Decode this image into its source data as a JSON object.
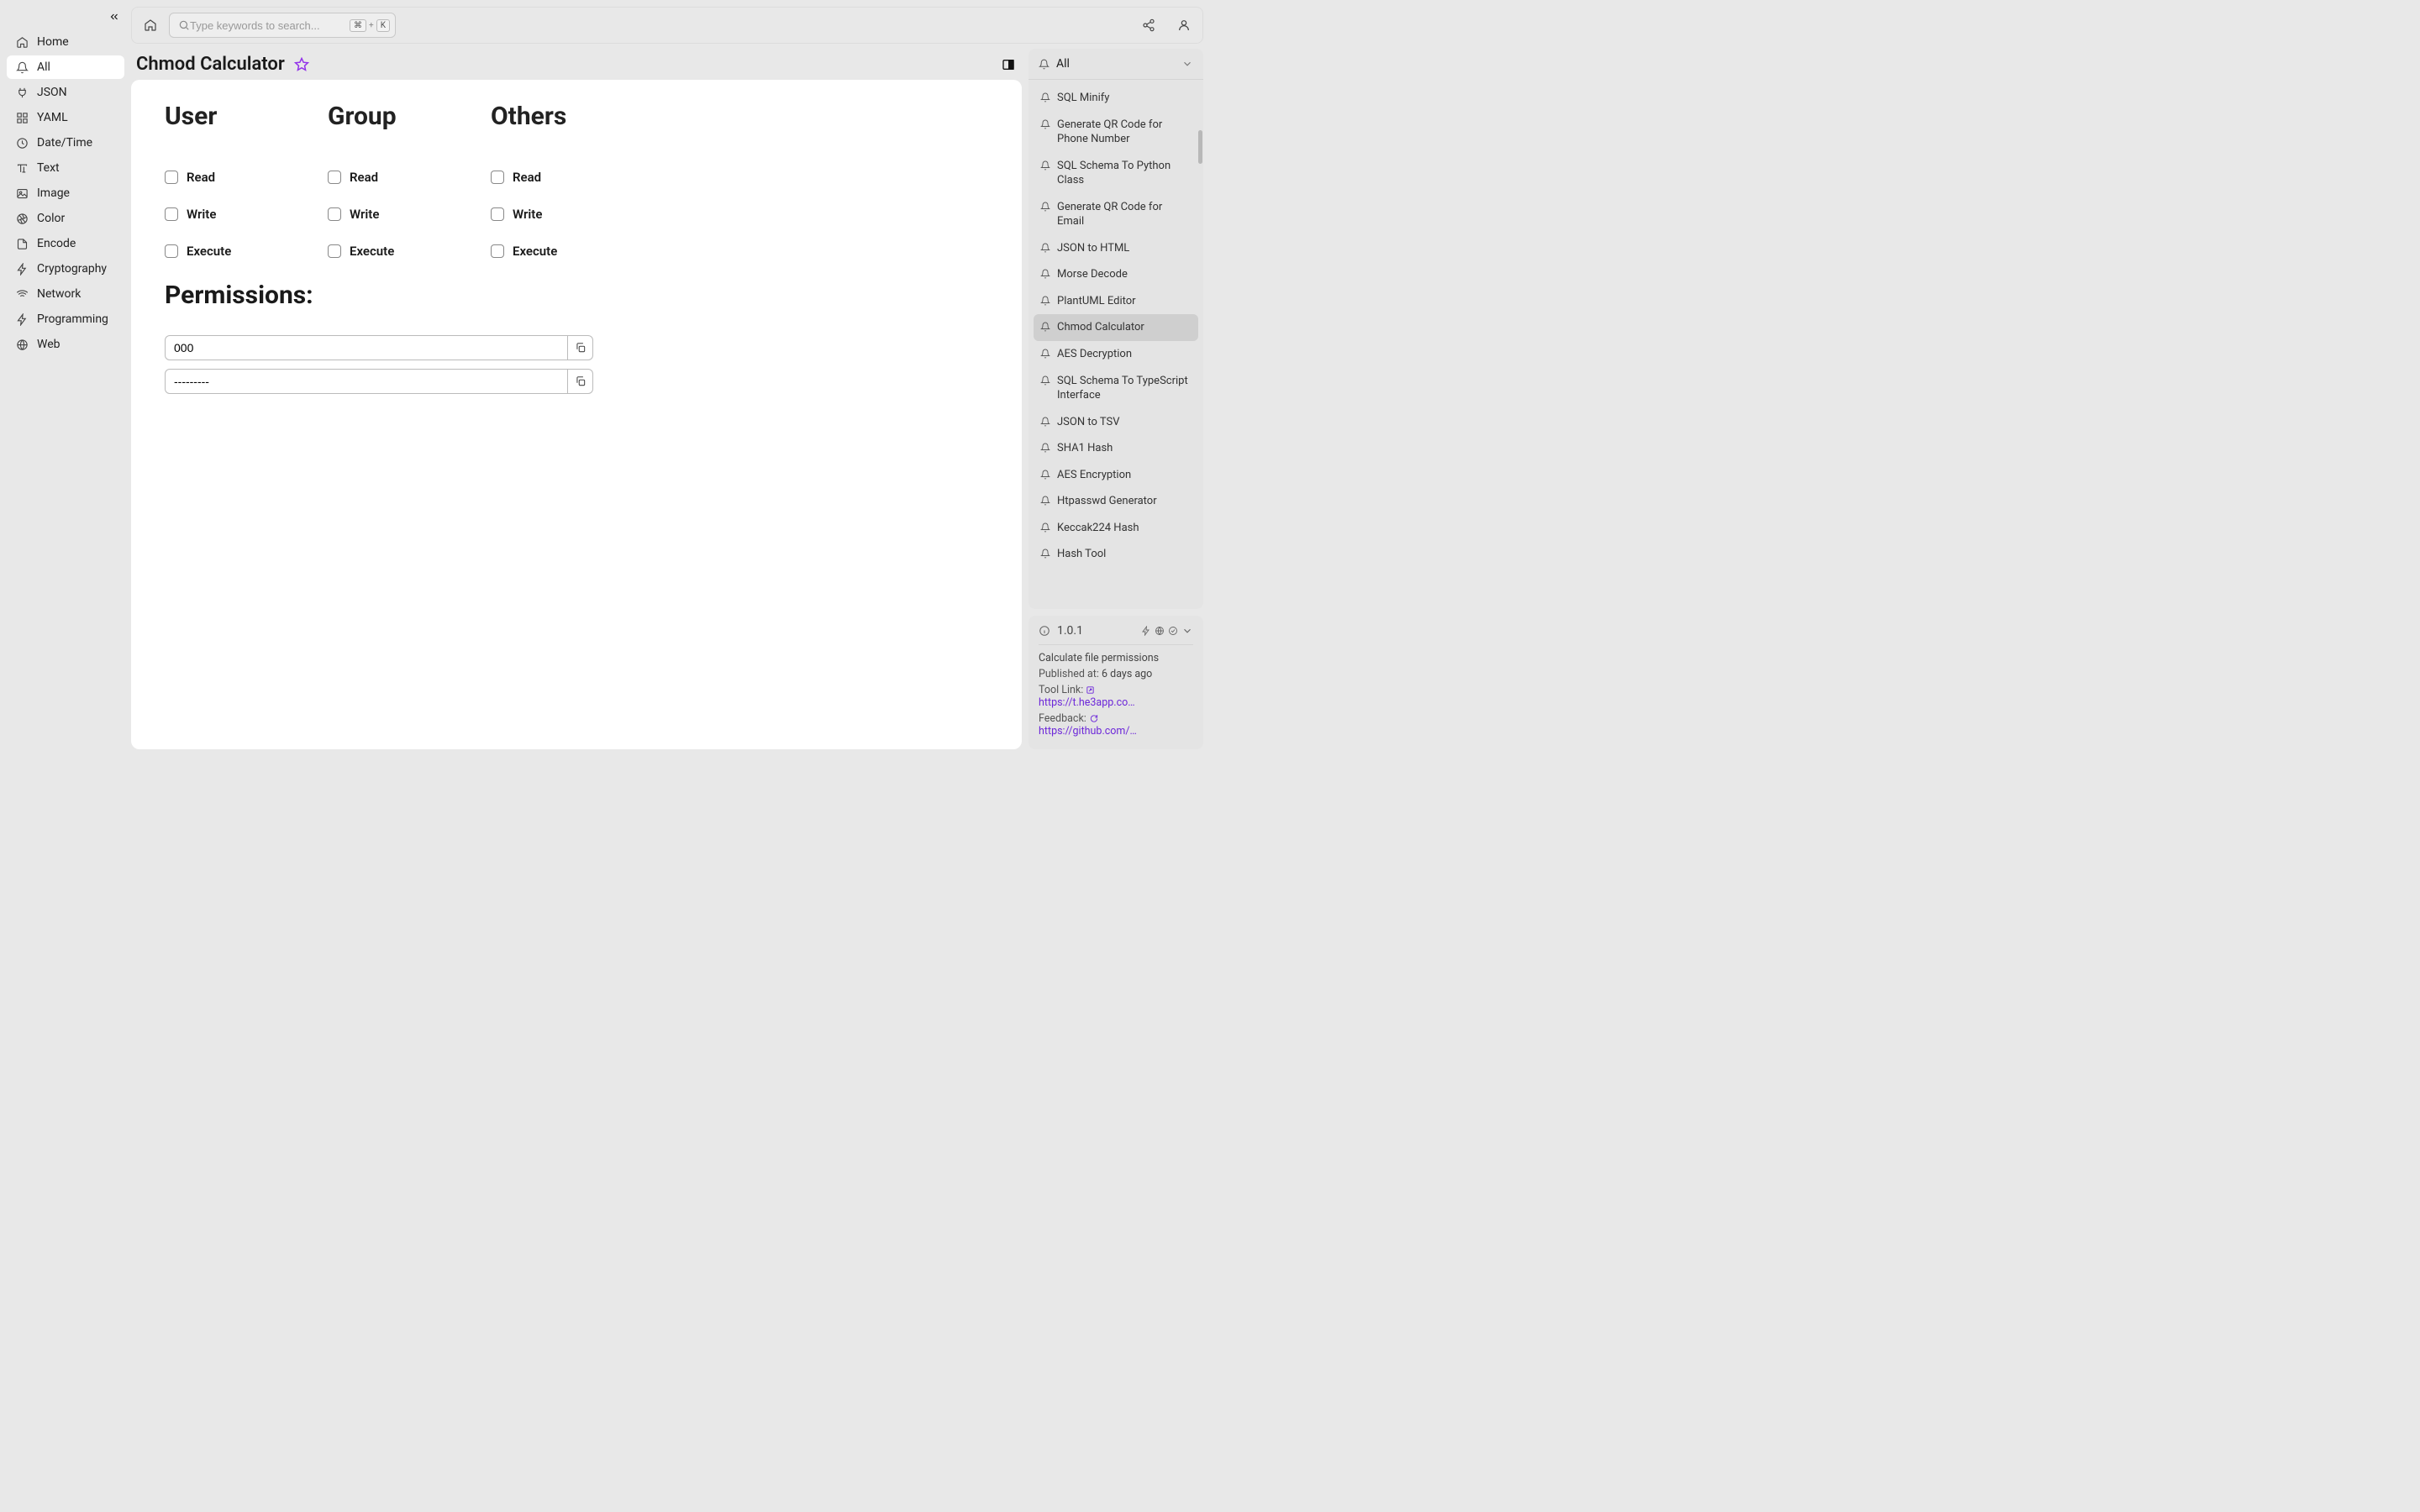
{
  "search": {
    "placeholder": "Type keywords to search...",
    "kbd1": "⌘",
    "kbd2": "K"
  },
  "sidebar": {
    "items": [
      {
        "label": "Home"
      },
      {
        "label": "All"
      },
      {
        "label": "JSON"
      },
      {
        "label": "YAML"
      },
      {
        "label": "Date/Time"
      },
      {
        "label": "Text"
      },
      {
        "label": "Image"
      },
      {
        "label": "Color"
      },
      {
        "label": "Encode"
      },
      {
        "label": "Cryptography"
      },
      {
        "label": "Network"
      },
      {
        "label": "Programming"
      },
      {
        "label": "Web"
      }
    ]
  },
  "page": {
    "title": "Chmod Calculator"
  },
  "tool": {
    "columns": [
      "User",
      "Group",
      "Others"
    ],
    "perms": [
      "Read",
      "Write",
      "Execute"
    ],
    "permissions_label": "Permissions:",
    "octal": "000",
    "symbolic": "---------"
  },
  "right": {
    "all_label": "All",
    "items": [
      "SQL Minify",
      "Generate QR Code for Phone Number",
      "SQL Schema To Python Class",
      "Generate QR Code for Email",
      "JSON to HTML",
      "Morse Decode",
      "PlantUML Editor",
      "Chmod Calculator",
      "AES Decryption",
      "SQL Schema To TypeScript Interface",
      "JSON to TSV",
      "SHA1 Hash",
      "AES Encryption",
      "Htpasswd Generator",
      "Keccak224 Hash",
      "Hash Tool"
    ],
    "active_index": 7
  },
  "info": {
    "version": "1.0.1",
    "description": "Calculate file permissions",
    "published_label": "Published at:",
    "published_value": "6 days ago",
    "tool_link_label": "Tool Link:",
    "tool_link_value": "https://t.he3app.co…",
    "feedback_label": "Feedback:",
    "feedback_value": "https://github.com/…"
  }
}
